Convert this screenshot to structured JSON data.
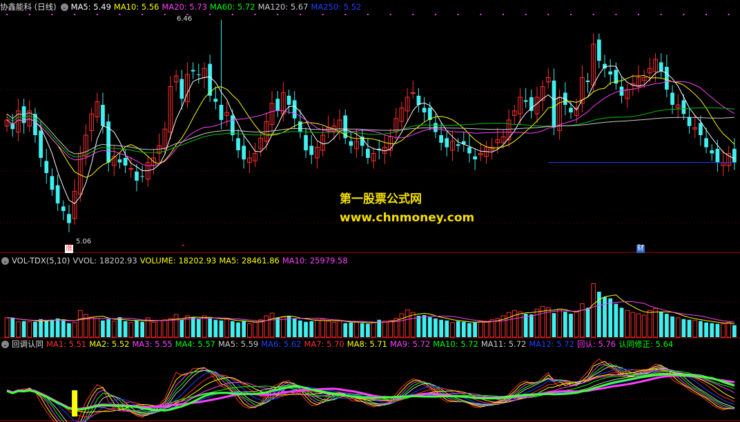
{
  "main": {
    "title": "协鑫能科 (日线)",
    "indicators": [
      {
        "label": "MA5: 5.49",
        "color": "#ffffff"
      },
      {
        "label": "MA10: 5.56",
        "color": "#ffff00"
      },
      {
        "label": "MA20: 5.73",
        "color": "#ff40ff"
      },
      {
        "label": "MA60: 5.72",
        "color": "#00ff00"
      },
      {
        "label": "MA120: 5.67",
        "color": "#cccccc"
      },
      {
        "label": "MA250: 5.52",
        "color": "#2040ff"
      }
    ],
    "high_label": "6.46",
    "low_label": "5.06",
    "tags": [
      {
        "text": "涨",
        "color": "#ff3030",
        "bg": "#ffffff"
      },
      {
        "text": "⌃",
        "color": "#ff3030",
        "bg": ""
      },
      {
        "text": "财",
        "color": "#ffffff",
        "bg": "#3060c0"
      }
    ]
  },
  "watermark": {
    "line1": "第一股票公式网",
    "line2": "www.chnmoney.com"
  },
  "volume": {
    "title": "VOL-TDX(5,10)",
    "indicators": [
      {
        "label": "VVOL: 18202.93",
        "color": "#cccccc"
      },
      {
        "label": "VOLUME: 18202.93",
        "color": "#ffff00"
      },
      {
        "label": "MA5: 28461.86",
        "color": "#ffff00"
      },
      {
        "label": "MA10: 25979.58",
        "color": "#ff40ff"
      }
    ]
  },
  "bottom": {
    "title": "回调认同",
    "indicators": [
      {
        "label": "MA1: 5.51",
        "color": "#ff3030"
      },
      {
        "label": "MA2: 5.52",
        "color": "#ffff00"
      },
      {
        "label": "MA3: 5.55",
        "color": "#ff40ff"
      },
      {
        "label": "MA4: 5.57",
        "color": "#00ff00"
      },
      {
        "label": "MA5: 5.59",
        "color": "#cccccc"
      },
      {
        "label": "MA6: 5.62",
        "color": "#2040ff"
      },
      {
        "label": "MA7: 5.70",
        "color": "#ff3030"
      },
      {
        "label": "MA8: 5.71",
        "color": "#ffff00"
      },
      {
        "label": "MA9: 5.72",
        "color": "#ff40ff"
      },
      {
        "label": "MA10: 5.72",
        "color": "#00ff00"
      },
      {
        "label": "MA11: 5.72",
        "color": "#cccccc"
      },
      {
        "label": "MA12: 5.72",
        "color": "#2040ff"
      },
      {
        "label": "回认: 5.76",
        "color": "#ff40ff"
      },
      {
        "label": "认同修正: 5.64",
        "color": "#00ff00"
      }
    ]
  },
  "chart_data": {
    "type": "candlestick",
    "price_range": [
      5.0,
      6.5
    ],
    "closes": [
      5.8,
      5.74,
      5.86,
      5.78,
      5.86,
      5.7,
      5.55,
      5.45,
      5.34,
      5.25,
      5.2,
      5.12,
      5.33,
      5.58,
      5.7,
      5.84,
      5.92,
      5.76,
      5.52,
      5.56,
      5.52,
      5.5,
      5.48,
      5.4,
      5.43,
      5.52,
      5.55,
      5.63,
      5.74,
      6.02,
      6.09,
      5.94,
      6.1,
      6.12,
      6.1,
      6.14,
      5.96,
      5.92,
      5.8,
      5.85,
      5.7,
      5.6,
      5.54,
      5.55,
      5.58,
      5.68,
      5.79,
      5.91,
      5.86,
      5.98,
      5.9,
      5.81,
      5.72,
      5.6,
      5.57,
      5.62,
      5.7,
      5.75,
      5.76,
      5.8,
      5.68,
      5.63,
      5.66,
      5.63,
      5.55,
      5.58,
      5.6,
      5.62,
      5.69,
      5.81,
      5.88,
      5.95,
      5.98,
      5.9,
      5.85,
      5.8,
      5.72,
      5.65,
      5.62,
      5.66,
      5.63,
      5.64,
      5.58,
      5.54,
      5.58,
      5.62,
      5.62,
      5.67,
      5.69,
      5.8,
      5.86,
      5.95,
      5.92,
      5.86,
      5.95,
      6.02,
      6.08,
      5.75,
      5.95,
      5.9,
      5.85,
      5.88,
      6.08,
      6.05,
      6.3,
      6.19,
      6.14,
      6.1,
      6.04,
      5.96,
      6.0,
      6.04,
      6.08,
      6.08,
      6.14,
      6.2,
      6.12,
      6.0,
      5.9,
      5.9,
      5.84,
      5.76,
      5.75,
      5.7,
      5.62,
      5.58,
      5.52,
      5.52,
      5.58,
      5.52
    ],
    "volume_range": [
      0,
      100000
    ],
    "volumes": [
      29000,
      29000,
      23000,
      24000,
      23000,
      23000,
      27000,
      25000,
      26000,
      28000,
      25000,
      21000,
      22000,
      40000,
      34000,
      30000,
      28000,
      25000,
      27000,
      24000,
      30000,
      24000,
      22000,
      25000,
      23000,
      29000,
      22000,
      25000,
      26000,
      28000,
      34000,
      26000,
      32000,
      30000,
      27000,
      32000,
      28000,
      26000,
      25000,
      27000,
      24000,
      22000,
      24000,
      20000,
      23000,
      26000,
      32000,
      36000,
      29000,
      30000,
      31000,
      28000,
      25000,
      23000,
      24000,
      26000,
      27000,
      24000,
      22000,
      25000,
      21000,
      22000,
      23000,
      21000,
      20000,
      22000,
      26000,
      24000,
      25000,
      28000,
      35000,
      41000,
      37000,
      32000,
      33000,
      30000,
      28000,
      26000,
      25000,
      22000,
      24000,
      23000,
      21000,
      22000,
      24000,
      23000,
      26000,
      28000,
      32000,
      37000,
      40000,
      38000,
      35000,
      34000,
      42000,
      46000,
      44000,
      36000,
      42000,
      38000,
      35000,
      38000,
      50000,
      44000,
      80000,
      68000,
      60000,
      58000,
      50000,
      44000,
      40000,
      37000,
      35000,
      33000,
      40000,
      43000,
      38000,
      35000,
      31000,
      29000,
      27000,
      26000,
      25000,
      24000,
      22000,
      21000,
      20000,
      20000,
      22000,
      18000
    ],
    "indicator_range": [
      5.0,
      6.5
    ],
    "marker_index": 12
  }
}
